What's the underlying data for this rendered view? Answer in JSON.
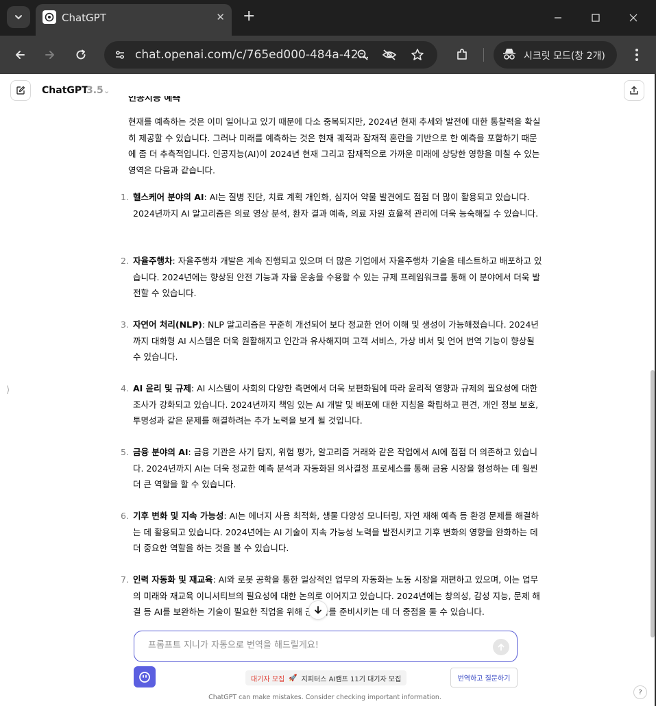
{
  "browser": {
    "tab_title": "ChatGPT",
    "url": "chat.openai.com/c/765ed000-484a-42...",
    "incognito_label": "시크릿 모드(창 2개)"
  },
  "header": {
    "model_name": "ChatGPT",
    "model_version": "3.5"
  },
  "message": {
    "cut_heading": "인공지능 예측",
    "intro": "현재를 예측하는 것은 이미 일어나고 있기 때문에 다소 중복되지만, 2024년 현재 추세와 발전에 대한 통찰력을 확실히 제공할 수 있습니다. 그러나 미래를 예측하는 것은 현재 궤적과 잠재적 혼란을 기반으로 한 예측을 포함하기 때문에 좀 더 추측적입니다. 인공지능(AI)이 2024년 현재 그리고 잠재적으로 가까운 미래에 상당한 영향을 미칠 수 있는 영역은 다음과 같습니다.",
    "items": [
      {
        "num": "1.",
        "title": "헬스케어 분야의 AI",
        "text": ": AI는 질병 진단, 치료 계획 개인화, 심지어 약물 발견에도 점점 더 많이 활용되고 있습니다. 2024년까지 AI 알고리즘은 의료 영상 분석, 환자 결과 예측, 의료 자원 효율적 관리에 더욱 능숙해질 수 있습니다."
      },
      {
        "num": "2.",
        "title": "자율주행차",
        "text": ": 자율주행차 개발은 계속 진행되고 있으며 더 많은 기업에서 자율주행차 기술을 테스트하고 배포하고 있습니다. 2024년에는 향상된 안전 기능과 자율 운송을 수용할 수 있는 규제 프레임워크를 통해 이 분야에서 더욱 발전할 수 있습니다."
      },
      {
        "num": "3.",
        "title": "자연어 처리(NLP)",
        "text": ": NLP 알고리즘은 꾸준히 개선되어 보다 정교한 언어 이해 및 생성이 가능해졌습니다. 2024년까지 대화형 AI 시스템은 더욱 원활해지고 인간과 유사해지며 고객 서비스, 가상 비서 및 언어 번역 기능이 향상될 수 있습니다."
      },
      {
        "num": "4.",
        "title": "AI 윤리 및 규제",
        "text": ": AI 시스템이 사회의 다양한 측면에서 더욱 보편화됨에 따라 윤리적 영향과 규제의 필요성에 대한 조사가 강화되고 있습니다. 2024년까지 책임 있는 AI 개발 및 배포에 대한 지침을 확립하고 편견, 개인 정보 보호, 투명성과 같은 문제를 해결하려는 추가 노력을 보게 될 것입니다."
      },
      {
        "num": "5.",
        "title": "금융 분야의 AI",
        "text": ": 금융 기관은 사기 탐지, 위험 평가, 알고리즘 거래와 같은 작업에서 AI에 점점 더 의존하고 있습니다. 2024년까지 AI는 더욱 정교한 예측 분석과 자동화된 의사결정 프로세스를 통해 금융 시장을 형성하는 데 훨씬 더 큰 역할을 할 수 있습니다."
      },
      {
        "num": "6.",
        "title": "기후 변화 및 지속 가능성",
        "text": ": AI는 에너지 사용 최적화, 생물 다양성 모니터링, 자연 재해 예측 등 환경 문제를 해결하는 데 활용되고 있습니다. 2024년에는 AI 기술이 지속 가능성 노력을 발전시키고 기후 변화의 영향을 완화하는 데 더 중요한 역할을 하는 것을 볼 수 있습니다."
      },
      {
        "num": "7.",
        "title": "인력 자동화 및 재교육",
        "text": ": AI와 로봇 공학을 통한 일상적인 업무의 자동화는 노동 시장을 재편하고 있으며, 이는 업무의 미래와 재교육 이니셔티브의 필요성에 대한 논의로 이어지고 있습니다. 2024년에는 창의성, 감성 지능, 문제 해결 등 AI를 보완하는 기술이 필요한 직업을 위해 근로자를 준비시키는 데 더 중점을 둘 수 있습니다."
      }
    ]
  },
  "composer": {
    "placeholder": "프롬프트 지니가 자동으로 번역을 해드릴게요!"
  },
  "promo": {
    "tag": "대기자 모집",
    "emoji": "🚀",
    "text": "지피터스 AI캠프 11기 대기자 모집"
  },
  "translate_button": "번역하고 질문하기",
  "disclaimer": "ChatGPT can make mistakes. Consider checking important information.",
  "help_label": "?",
  "sidebar_toggle_glyph": "⟩",
  "colors": {
    "accent": "#5a5fd6",
    "chrome_dark": "#1f1f1f",
    "chrome_toolbar": "#3c3c3c",
    "promo_tag": "#e0453a"
  }
}
